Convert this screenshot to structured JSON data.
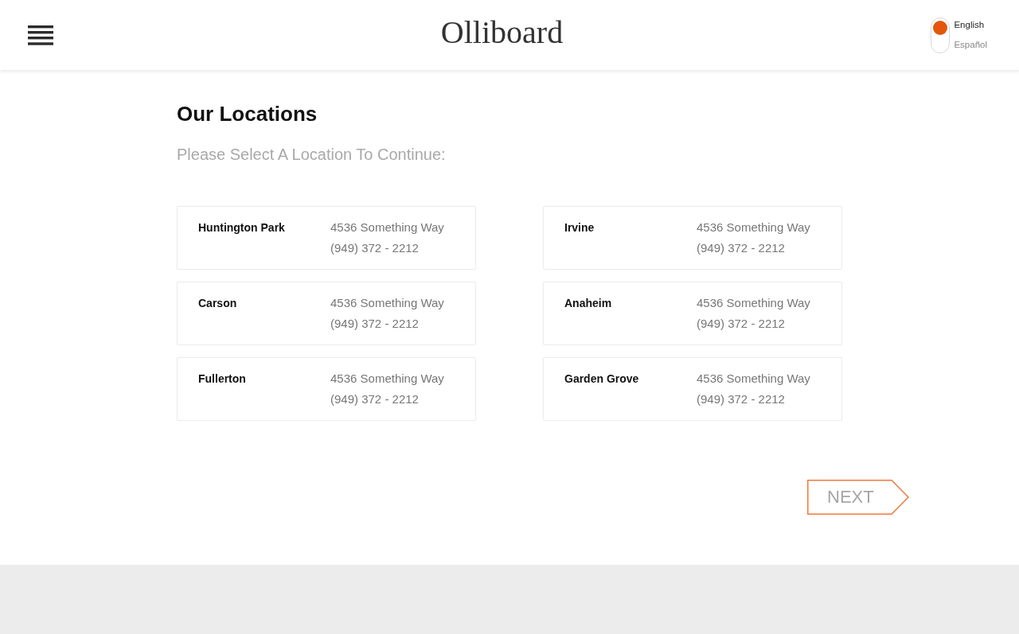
{
  "header": {
    "logo": "Olliboard",
    "language_toggle": {
      "options": [
        {
          "label": "English",
          "selected": true
        },
        {
          "label": "Español",
          "selected": false
        }
      ]
    }
  },
  "page": {
    "title": "Our Locations",
    "subtitle": "Please Select A Location To Continue:"
  },
  "locations": [
    {
      "name": "Huntington Park",
      "address": "4536 Something Way",
      "phone": "(949) 372 - 2212",
      "selected": false
    },
    {
      "name": "Irvine",
      "address": "4536 Something Way",
      "phone": "(949) 372 - 2212",
      "selected": false
    },
    {
      "name": "Carson",
      "address": "4536 Something Way",
      "phone": "(949) 372 - 2212",
      "selected": false
    },
    {
      "name": "Anaheim",
      "address": "4536 Something Way",
      "phone": "(949) 372 - 2212",
      "selected": false
    },
    {
      "name": "Fullerton",
      "address": "4536 Something Way",
      "phone": "(949) 372 - 2212",
      "selected": false
    },
    {
      "name": "Garden Grove",
      "address": "4536 Something Way",
      "phone": "(949) 372 - 2212",
      "selected": false
    }
  ],
  "next_button": {
    "label": "NEXT",
    "disabled": true
  }
}
